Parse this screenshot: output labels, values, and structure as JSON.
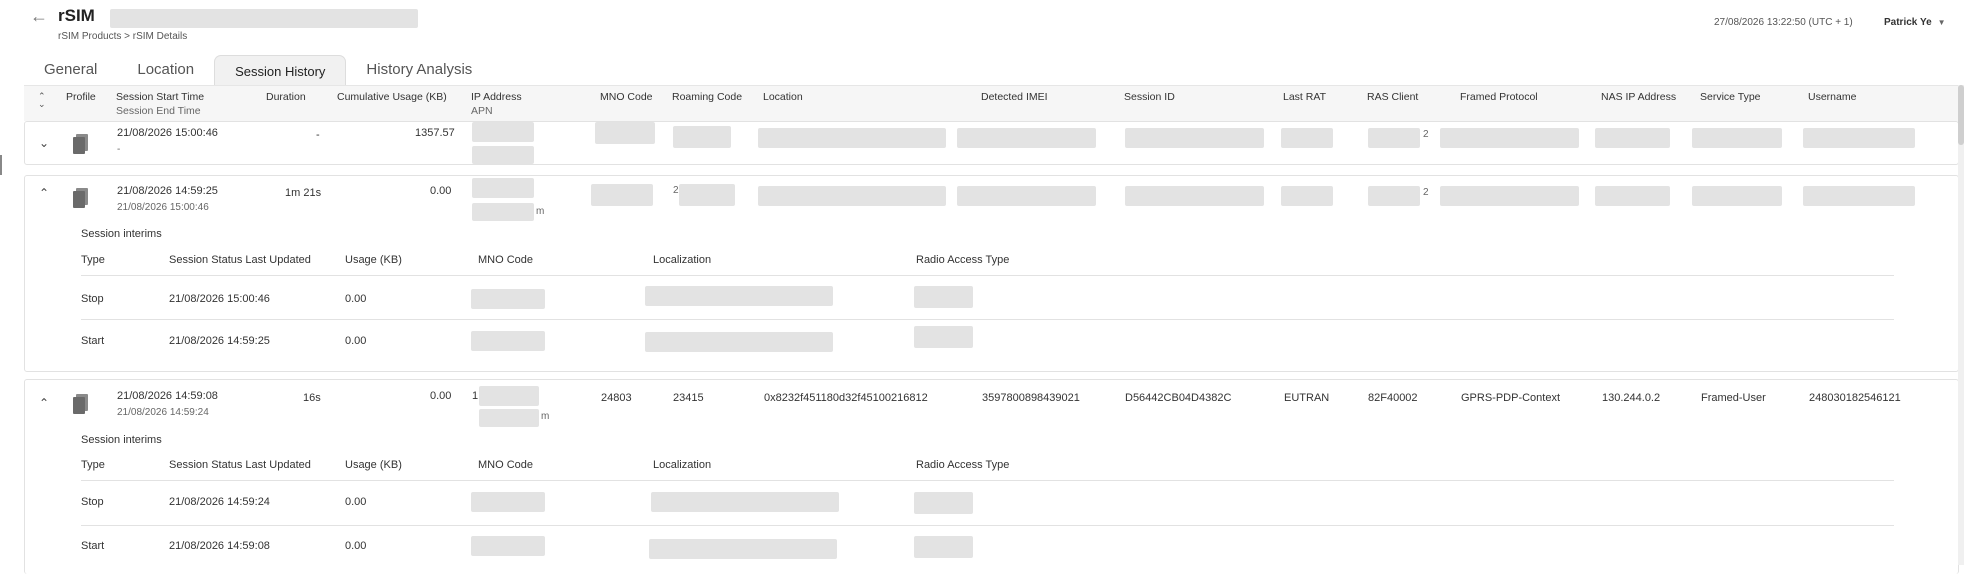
{
  "header": {
    "title": "rSIM",
    "breadcrumb": [
      "rSIM Products",
      "rSIM Details"
    ],
    "breadcrumb_sep": ">",
    "datetime": "27/08/2026 13:22:50 (UTC + 1)",
    "user": "Patrick Ye"
  },
  "tabs": [
    {
      "label": "General",
      "active": false
    },
    {
      "label": "Location",
      "active": false
    },
    {
      "label": "Session History",
      "active": true
    },
    {
      "label": "History Analysis",
      "active": false
    }
  ],
  "columns": {
    "profile": "Profile",
    "start": "Session Start Time",
    "end": "Session End Time",
    "duration": "Duration",
    "usage": "Cumulative Usage (KB)",
    "ip": "IP Address",
    "apn": "APN",
    "mno": "MNO Code",
    "roaming": "Roaming Code",
    "location": "Location",
    "imei": "Detected IMEI",
    "session_id": "Session ID",
    "last_rat": "Last RAT",
    "ras": "RAS Client",
    "framed": "Framed Protocol",
    "nas": "NAS IP Address",
    "service": "Service Type",
    "username": "Username"
  },
  "rows": [
    {
      "start": "21/08/2026 15:00:46",
      "end": "-",
      "duration": "-",
      "usage": "1357.57",
      "ras_partial": "2"
    },
    {
      "start": "21/08/2026 14:59:25",
      "end": "21/08/2026 15:00:46",
      "duration": "1m 21s",
      "usage": "0.00",
      "ras_partial": "2",
      "roaming_partial": "2",
      "ip_partial": "m"
    },
    {
      "start": "21/08/2026 14:59:08",
      "end": "21/08/2026 14:59:24",
      "duration": "16s",
      "usage": "0.00",
      "ip_partial": "1",
      "apn_partial": "m",
      "mno": "24803",
      "roaming": "23415",
      "location": "0x8232f451180d32f45100216812",
      "imei": "3597800898439021",
      "session_id": "D56442CB04D4382C",
      "last_rat": "EUTRAN",
      "ras": "82F40002",
      "framed": "GPRS-PDP-Context",
      "nas": "130.244.0.2",
      "service": "Framed-User",
      "username": "248030182546121"
    }
  ],
  "interims": {
    "title": "Session interims",
    "headers": [
      "Type",
      "Session Status Last Updated",
      "Usage (KB)",
      "MNO Code",
      "Localization",
      "Radio Access Type"
    ],
    "row2": [
      {
        "type": "Stop",
        "updated": "21/08/2026 15:00:46",
        "usage": "0.00"
      },
      {
        "type": "Start",
        "updated": "21/08/2026 14:59:25",
        "usage": "0.00"
      }
    ],
    "row3": [
      {
        "type": "Stop",
        "updated": "21/08/2026 14:59:24",
        "usage": "0.00"
      },
      {
        "type": "Start",
        "updated": "21/08/2026 14:59:08",
        "usage": "0.00"
      }
    ]
  },
  "icons": {
    "back": "back-arrow-icon",
    "profile": "document-icon",
    "expand": "chevron-down-icon",
    "collapse": "chevron-up-icon",
    "sort": "sort-icon",
    "user_menu": "caret-down-icon"
  }
}
